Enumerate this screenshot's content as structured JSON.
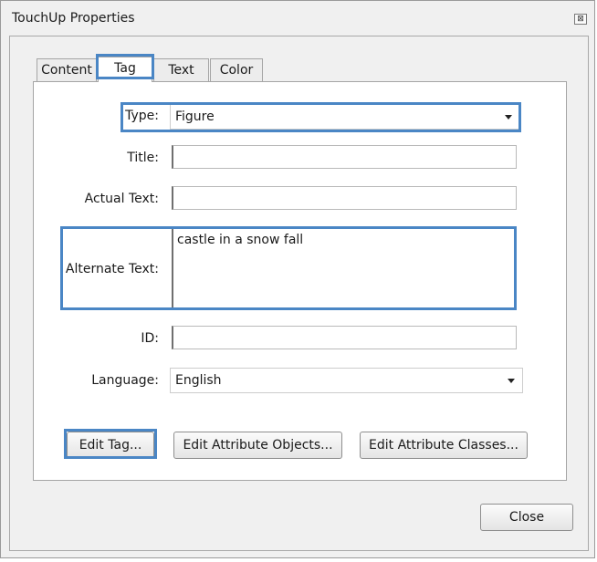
{
  "window": {
    "title": "TouchUp Properties",
    "close_glyph": "⊠"
  },
  "tabs": [
    {
      "label": "Content"
    },
    {
      "label": "Tag"
    },
    {
      "label": "Text"
    },
    {
      "label": "Color"
    }
  ],
  "active_tab": "Tag",
  "form": {
    "type_label": "Type:",
    "type_value": "Figure",
    "title_label": "Title:",
    "title_value": "",
    "actual_text_label": "Actual Text:",
    "actual_text_value": "",
    "alternate_text_label": "Alternate Text:",
    "alternate_text_value": "castle in a snow fall",
    "id_label": "ID:",
    "id_value": "",
    "language_label": "Language:",
    "language_value": "English"
  },
  "buttons": {
    "edit_tag": "Edit Tag...",
    "edit_attribute_objects": "Edit Attribute Objects...",
    "edit_attribute_classes": "Edit Attribute Classes...",
    "close": "Close"
  },
  "colors": {
    "highlight": "#4a86c5",
    "dialog_bg": "#f0f0f0"
  }
}
